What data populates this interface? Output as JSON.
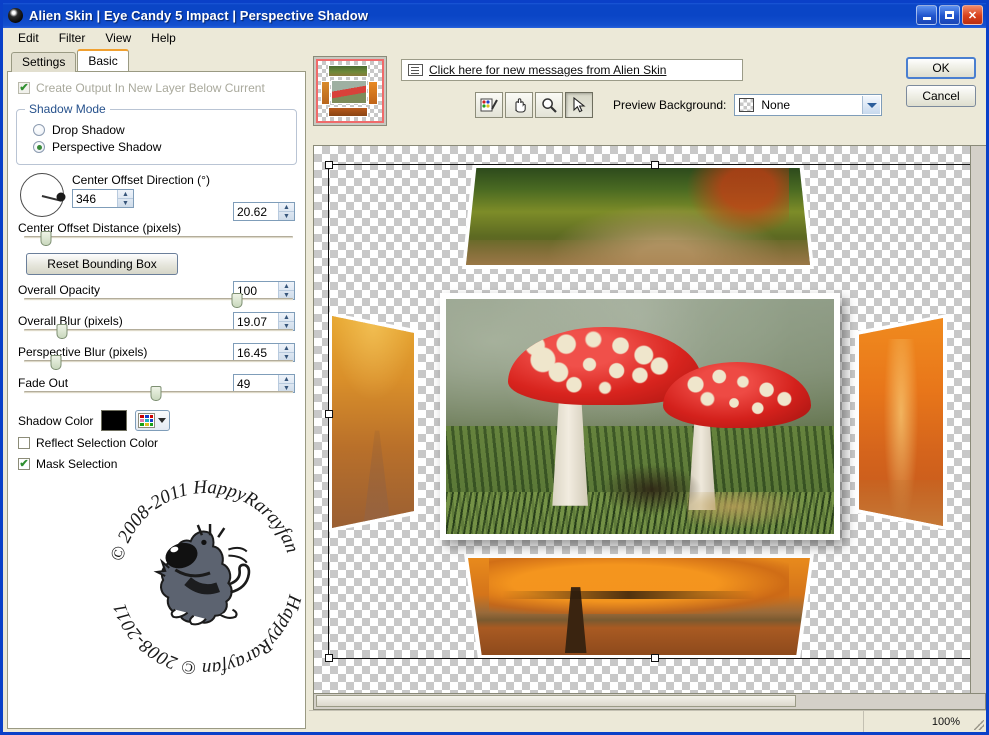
{
  "window": {
    "title": "Alien Skin | Eye Candy 5 Impact | Perspective Shadow",
    "logo_icon": "alien-head-icon",
    "minimize_icon": "minimize-icon",
    "maximize_icon": "maximize-icon",
    "close_label": "✕"
  },
  "menu": {
    "items": [
      "Edit",
      "Filter",
      "View",
      "Help"
    ]
  },
  "tabs": [
    {
      "label": "Settings",
      "active": false
    },
    {
      "label": "Basic",
      "active": true
    }
  ],
  "panel": {
    "create_output_label": "Create Output In New Layer Below Current",
    "create_output_checked": true,
    "create_output_disabled": true,
    "shadow_mode": {
      "legend": "Shadow Mode",
      "options": [
        {
          "label": "Drop Shadow",
          "selected": false
        },
        {
          "label": "Perspective Shadow",
          "selected": true
        }
      ]
    },
    "center_offset_direction": {
      "label": "Center Offset Direction (°)",
      "value": "346",
      "dial_icon": "angle-dial-icon"
    },
    "sliders": [
      {
        "label": "Center Offset Distance (pixels)",
        "value": "20.62",
        "percent": 8
      },
      {
        "label": "Overall Opacity",
        "value": "100",
        "percent": 79
      },
      {
        "label": "Overall Blur (pixels)",
        "value": "19.07",
        "percent": 14
      },
      {
        "label": "Perspective Blur (pixels)",
        "value": "16.45",
        "percent": 12
      },
      {
        "label": "Fade Out",
        "value": "49",
        "percent": 49
      }
    ],
    "reset_button": "Reset Bounding Box",
    "shadow_color": {
      "label": "Shadow Color",
      "color": "#000000",
      "palette_icon": "color-palette-icon"
    },
    "reflect_selection": {
      "label": "Reflect Selection Color",
      "checked": false
    },
    "mask_selection": {
      "label": "Mask Selection",
      "checked": true
    }
  },
  "watermark": {
    "text_top": "© 2008-2011  HappyRarayfan",
    "text_bottom": "HappyRarayfan © 2008-2011",
    "dog_icon": "cartoon-dog-icon"
  },
  "toolbar": {
    "thumbnail_icon": "preview-thumbnail",
    "news_link": "Click here for new messages from Alien Skin",
    "mail_icon": "mail-icon",
    "tools": [
      {
        "name": "color-picker-tool",
        "icon": "eyedropper-palette-icon",
        "active": false
      },
      {
        "name": "pan-tool",
        "icon": "hand-icon",
        "active": false
      },
      {
        "name": "zoom-tool",
        "icon": "magnifier-icon",
        "active": false
      },
      {
        "name": "select-tool",
        "icon": "arrow-cursor-icon",
        "active": true
      }
    ],
    "preview_bg_label": "Preview Background:",
    "preview_bg_value": "None",
    "ok_label": "OK",
    "cancel_label": "Cancel"
  },
  "canvas": {
    "photos": [
      {
        "name": "photo-top",
        "caption": "forest path autumn canopy"
      },
      {
        "name": "photo-left",
        "caption": "autumn beech avenue"
      },
      {
        "name": "photo-center",
        "caption": "fly agaric mushrooms"
      },
      {
        "name": "photo-right",
        "caption": "orange autumn forest"
      },
      {
        "name": "photo-bottom",
        "caption": "large orange autumn tree"
      }
    ]
  },
  "statusbar": {
    "message": "",
    "zoom": "100%"
  }
}
